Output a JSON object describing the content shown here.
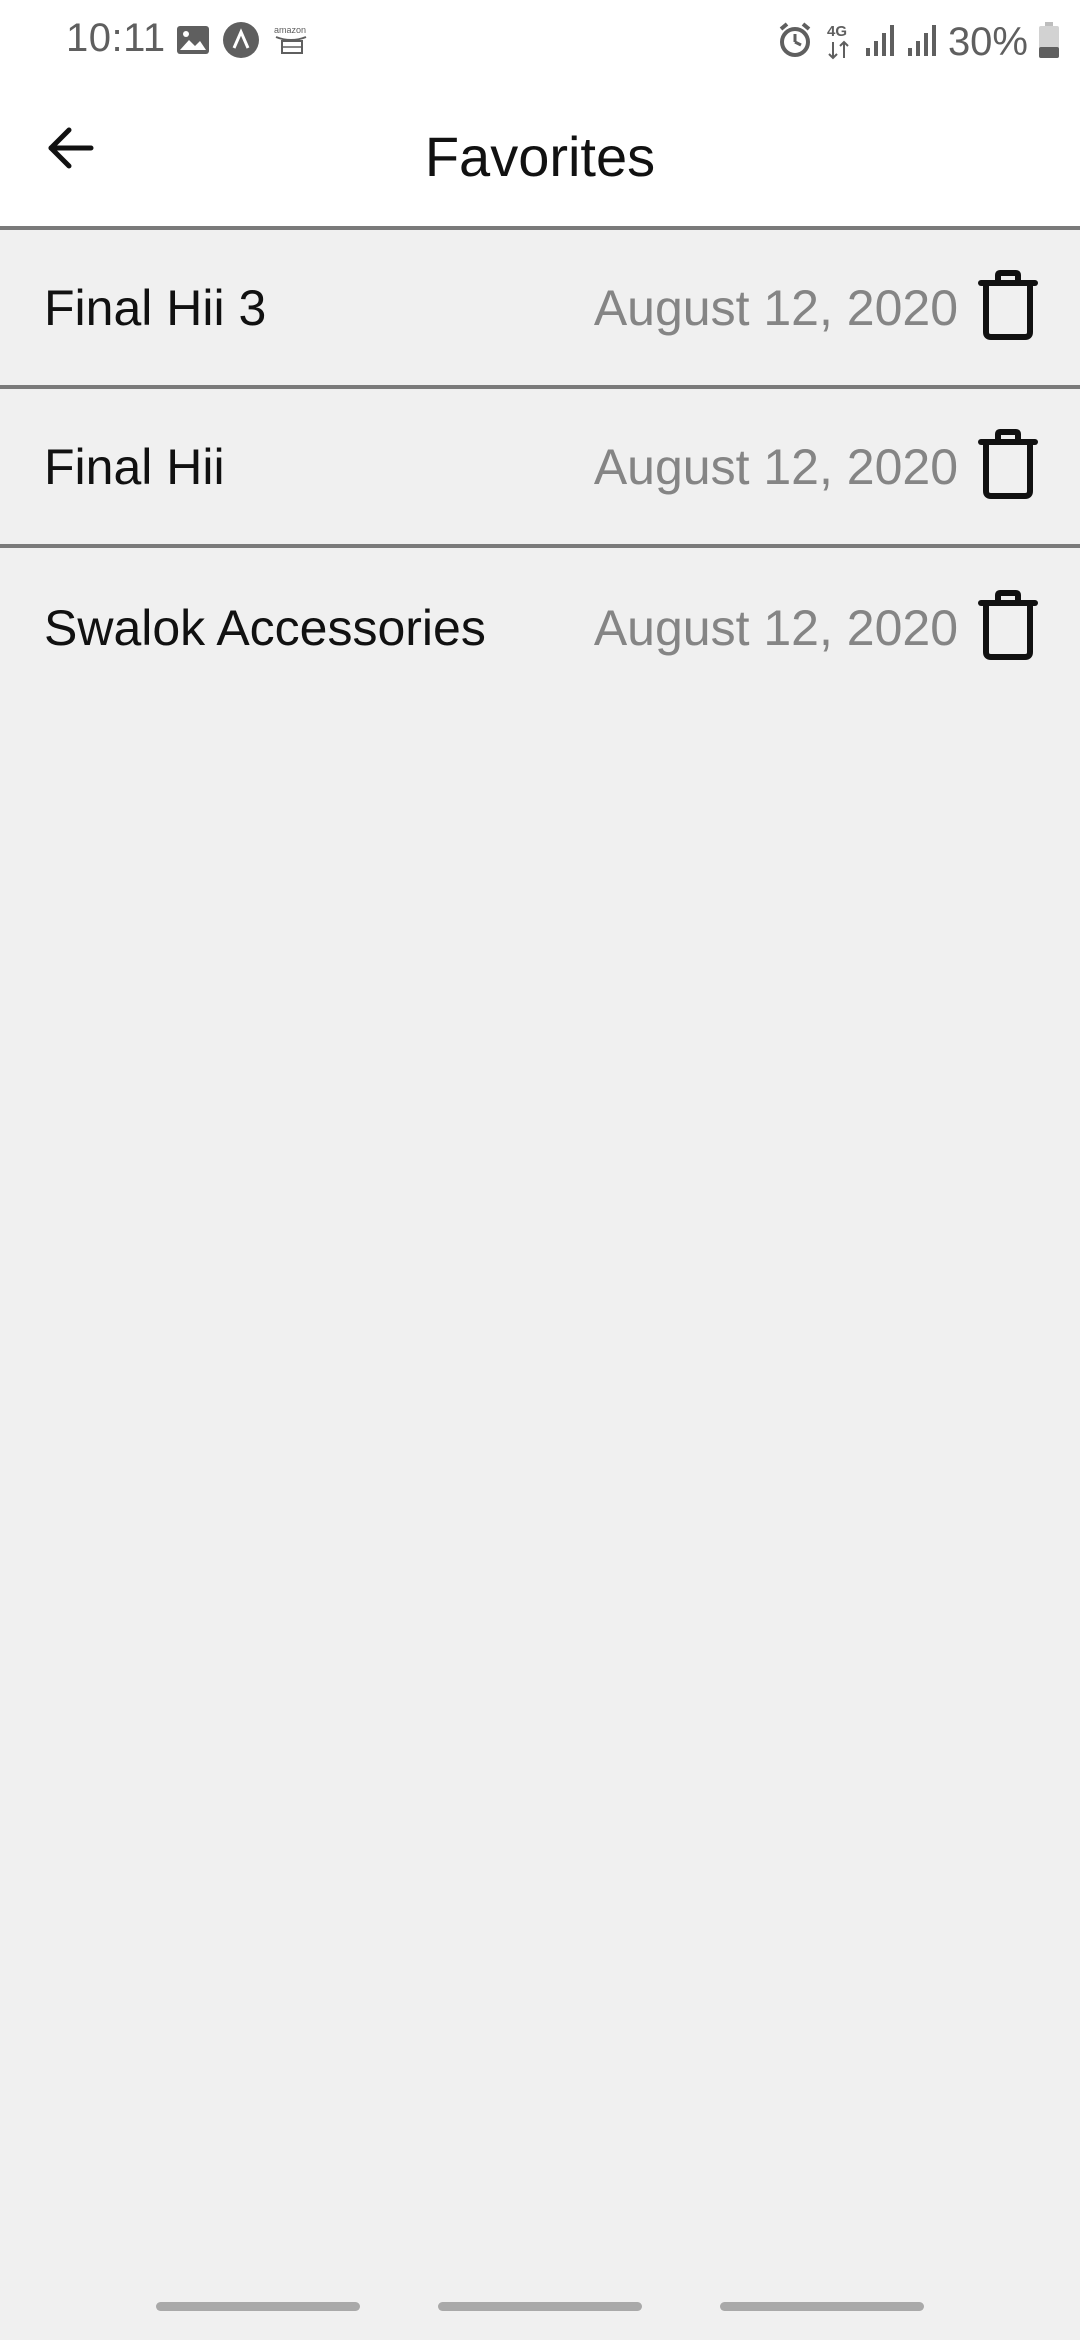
{
  "status_bar": {
    "time": "10:11",
    "battery_percent": "30%",
    "network": "4G",
    "left_icons": [
      "image-icon",
      "app-circle-icon",
      "amazon-icon"
    ],
    "right_icons": [
      "alarm-icon",
      "network-4g-icon",
      "signal-icon",
      "signal-icon",
      "battery-icon"
    ]
  },
  "app_bar": {
    "title": "Favorites",
    "back_icon": "arrow-left-icon"
  },
  "favorites": [
    {
      "name": "Final Hii 3",
      "date": "August 12, 2020",
      "icon": "trash-icon"
    },
    {
      "name": "Final Hii",
      "date": "August 12, 2020",
      "icon": "trash-icon"
    },
    {
      "name": "Swalok Accessories",
      "date": "August 12, 2020",
      "icon": "trash-icon"
    }
  ],
  "colors": {
    "background": "#f0f0f0",
    "divider": "#7a7a7a",
    "date_text": "#858585",
    "primary_text": "#111111"
  }
}
